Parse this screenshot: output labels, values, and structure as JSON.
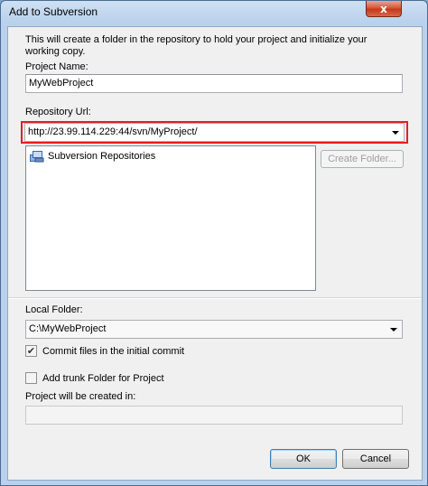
{
  "window": {
    "title": "Add to Subversion",
    "close_glyph": "x"
  },
  "intro_text": "This will create a folder in the repository to hold your project and initialize your working copy.",
  "project_name": {
    "label": "Project Name:",
    "value": "MyWebProject"
  },
  "repository_url": {
    "label": "Repository Url:",
    "value": "http://23.99.114.229:44/svn/MyProject/"
  },
  "repositories_tree": {
    "items": [
      {
        "label": "Subversion Repositories",
        "icon": "repository-icon"
      }
    ]
  },
  "create_folder_button": {
    "label": "Create Folder..."
  },
  "local_folder": {
    "label": "Local Folder:",
    "value": "C:\\MyWebProject"
  },
  "commit_checkbox": {
    "label": "Commit files in the initial commit",
    "checked": true,
    "glyph": "✔"
  },
  "trunk_checkbox": {
    "label": "Add trunk Folder for Project",
    "checked": false
  },
  "created_in": {
    "label": "Project will be created in:",
    "value": ""
  },
  "buttons": {
    "ok": "OK",
    "cancel": "Cancel"
  },
  "colors": {
    "highlight": "#e02020",
    "close_button": "#c4391a"
  }
}
